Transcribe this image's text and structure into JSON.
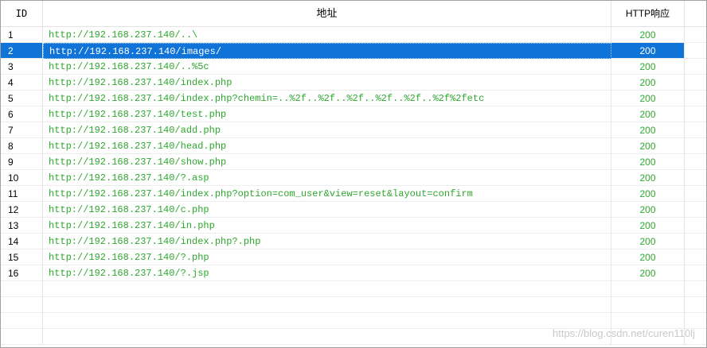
{
  "table": {
    "headers": {
      "id": "ID",
      "url": "地址",
      "http": "HTTP响应"
    },
    "selected_index": 1,
    "rows": [
      {
        "id": "1",
        "url": "http://192.168.237.140/..\\",
        "http": "200"
      },
      {
        "id": "2",
        "url": "http://192.168.237.140/images/",
        "http": "200"
      },
      {
        "id": "3",
        "url": "http://192.168.237.140/..%5c",
        "http": "200"
      },
      {
        "id": "4",
        "url": "http://192.168.237.140/index.php",
        "http": "200"
      },
      {
        "id": "5",
        "url": "http://192.168.237.140/index.php?chemin=..%2f..%2f..%2f..%2f..%2f..%2f%2fetc",
        "http": "200"
      },
      {
        "id": "6",
        "url": "http://192.168.237.140/test.php",
        "http": "200"
      },
      {
        "id": "7",
        "url": "http://192.168.237.140/add.php",
        "http": "200"
      },
      {
        "id": "8",
        "url": "http://192.168.237.140/head.php",
        "http": "200"
      },
      {
        "id": "9",
        "url": "http://192.168.237.140/show.php",
        "http": "200"
      },
      {
        "id": "10",
        "url": "http://192.168.237.140/?.asp",
        "http": "200"
      },
      {
        "id": "11",
        "url": "http://192.168.237.140/index.php?option=com_user&view=reset&layout=confirm",
        "http": "200"
      },
      {
        "id": "12",
        "url": "http://192.168.237.140/c.php",
        "http": "200"
      },
      {
        "id": "13",
        "url": "http://192.168.237.140/in.php",
        "http": "200"
      },
      {
        "id": "14",
        "url": "http://192.168.237.140/index.php?.php",
        "http": "200"
      },
      {
        "id": "15",
        "url": "http://192.168.237.140/?.php",
        "http": "200"
      },
      {
        "id": "16",
        "url": "http://192.168.237.140/?.jsp",
        "http": "200"
      }
    ]
  },
  "watermark": "https://blog.csdn.net/curen110lj",
  "colors": {
    "selection": "#0f73d8",
    "url_text": "#2ea82e",
    "grid": "#e6e6e6"
  }
}
